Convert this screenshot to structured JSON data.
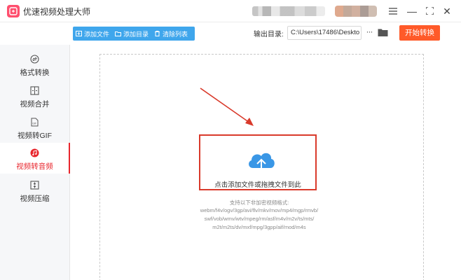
{
  "app": {
    "title": "优速视频处理大师"
  },
  "window_controls": {
    "menu_icon": "hamburger-icon",
    "minimize": "—",
    "maximize": "⛶",
    "close": "✕"
  },
  "toolbar": {
    "add_file": "添加文件",
    "add_folder": "添加目录",
    "clear_list": "清除列表",
    "output_label": "输出目录:",
    "output_path": "C:\\Users\\17486\\Deskto",
    "more": "···",
    "start": "开始转换"
  },
  "sidebar": {
    "items": [
      {
        "label": "格式转换",
        "icon": "format-convert-icon",
        "active": false
      },
      {
        "label": "视频合并",
        "icon": "video-merge-icon",
        "active": false
      },
      {
        "label": "视频转GIF",
        "icon": "gif-icon",
        "active": false
      },
      {
        "label": "视频转音频",
        "icon": "audio-extract-icon",
        "active": true
      },
      {
        "label": "视频压缩",
        "icon": "compress-icon",
        "active": false
      }
    ]
  },
  "main": {
    "drop_text": "点击添加文件或拖拽文件到此",
    "supported_title": "支持以下非加密视频格式:",
    "formats_lines": [
      "webm/f4v/ogv/3gp/avi/flv/mkv/mov/mp4/mgp/rmvb/",
      "swf/vob/wmv/wtv/mpeg/rm/asf/m4v/m2v/ts/mts/",
      "m2t/m2ts/dv/mxf/mpg/3gpp/aif/mod/m4s"
    ]
  },
  "colors": {
    "accent_blue": "#3fa6ec",
    "start_orange": "#ff5a29",
    "active_red": "#e8262d",
    "annotation_red": "#d93a2b"
  }
}
